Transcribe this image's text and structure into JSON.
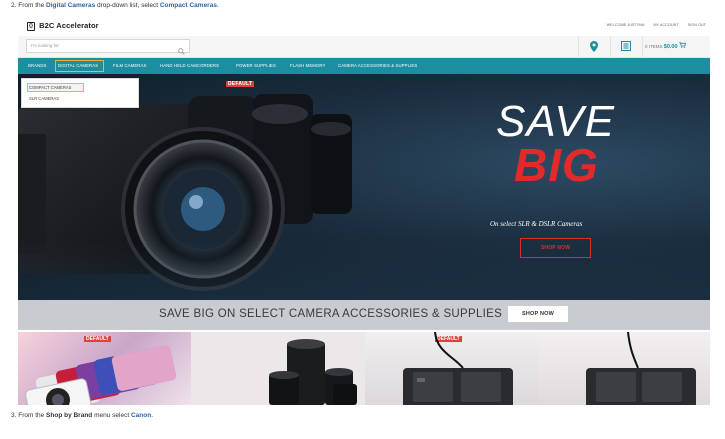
{
  "steps": {
    "step2": {
      "prefix": "2. From the ",
      "menu": "Digital Cameras",
      "middle": " drop-down list, select ",
      "item": "Compact Cameras",
      "suffix": "."
    },
    "step3": {
      "prefix": "3. From the ",
      "menu": "Shop by Brand",
      "middle": " menu select ",
      "item": "Canon",
      "suffix": "."
    }
  },
  "header": {
    "logo": "B2C Accelerator",
    "top_links": [
      "WELCOME JUSTYNA",
      "MY ACCOUNT",
      "SIGN OUT"
    ]
  },
  "search": {
    "placeholder": "I'm looking for"
  },
  "cart": {
    "items": "0 ITEMS",
    "amount": "$0.00"
  },
  "nav": {
    "items": [
      "BRANDS",
      "DIGITAL CAMERAS",
      "FILM CAMERAS",
      "HAND HELD CAMCORDERS",
      "POWER SUPPLIES",
      "FLASH MEMORY",
      "CAMERA ACCESSORIES & SUPPLIES"
    ]
  },
  "dropdown": {
    "items": [
      "COMPACT CAMERAS",
      "SLR CAMERAS"
    ]
  },
  "hero": {
    "badge": "DEFAULT",
    "headline1": "SAVE",
    "headline2": "BIG",
    "subtitle": "On select SLR & DSLR Cameras",
    "cta": "SHOP NOW"
  },
  "promo": {
    "text": "SAVE BIG ON SELECT CAMERA ACCESSORIES & SUPPLIES",
    "cta": "SHOP NOW"
  },
  "tiles": {
    "badge1": "DEFAULT",
    "badge2": "DEFAULT"
  },
  "colors": {
    "accent": "#1b8fa0",
    "highlight": "#f0b429",
    "sale_red": "#e32a2a",
    "link": "#2a66a8"
  }
}
